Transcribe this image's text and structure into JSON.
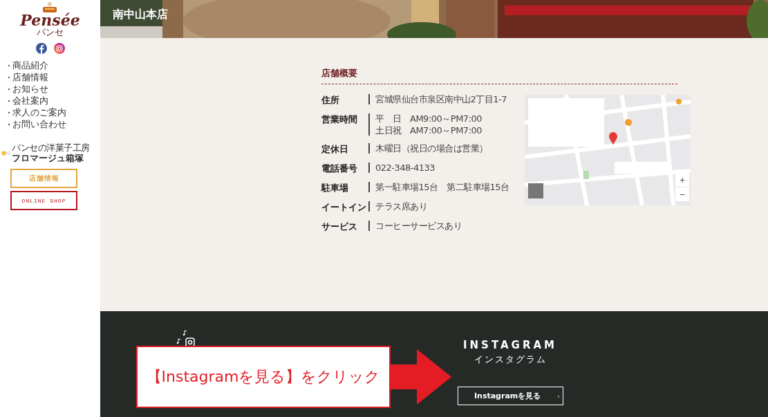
{
  "sidebar": {
    "logo": {
      "wordmark": "Pensée",
      "sub": "パンセ"
    },
    "nav": [
      "商品紹介",
      "店舗情報",
      "お知らせ",
      "会社案内",
      "求人のご案内",
      "お問い合わせ"
    ],
    "sister": {
      "tagline": "パンセの洋菓子工房",
      "name": "フロマージュ箱塚"
    },
    "buttons": [
      {
        "label": "店舗情報",
        "kind": "store"
      },
      {
        "label": "ONLINE SHOP",
        "kind": "shop"
      }
    ]
  },
  "header": {
    "title": "南中山本店"
  },
  "overview": {
    "title": "店舗概要",
    "rows": [
      {
        "label": "住所",
        "lines": [
          "宮城県仙台市泉区南中山2丁目1-7"
        ]
      },
      {
        "label": "営業時間",
        "lines": [
          "平　日　AM9:00～PM7:00",
          "土日祝　AM7:00～PM7:00"
        ]
      },
      {
        "label": "定休日",
        "lines": [
          "木曜日（祝日の場合は営業）"
        ]
      },
      {
        "label": "電話番号",
        "lines": [
          "022-348-4133"
        ]
      },
      {
        "label": "駐車場",
        "lines": [
          "第一駐車場15台　第二駐車場15台"
        ]
      },
      {
        "label": "イートイン",
        "lines": [
          "テラス席あり"
        ]
      },
      {
        "label": "サービス",
        "lines": [
          "コーヒーサービスあり"
        ]
      }
    ],
    "map": {
      "zoom": [
        "+",
        "−"
      ]
    }
  },
  "instagram": {
    "title": "INSTAGRAM",
    "subtitle": "インスタグラム",
    "button": "Instagramを見る",
    "button_icon": "›"
  },
  "annotation": {
    "text": "【Instagramを見る】をクリック"
  }
}
